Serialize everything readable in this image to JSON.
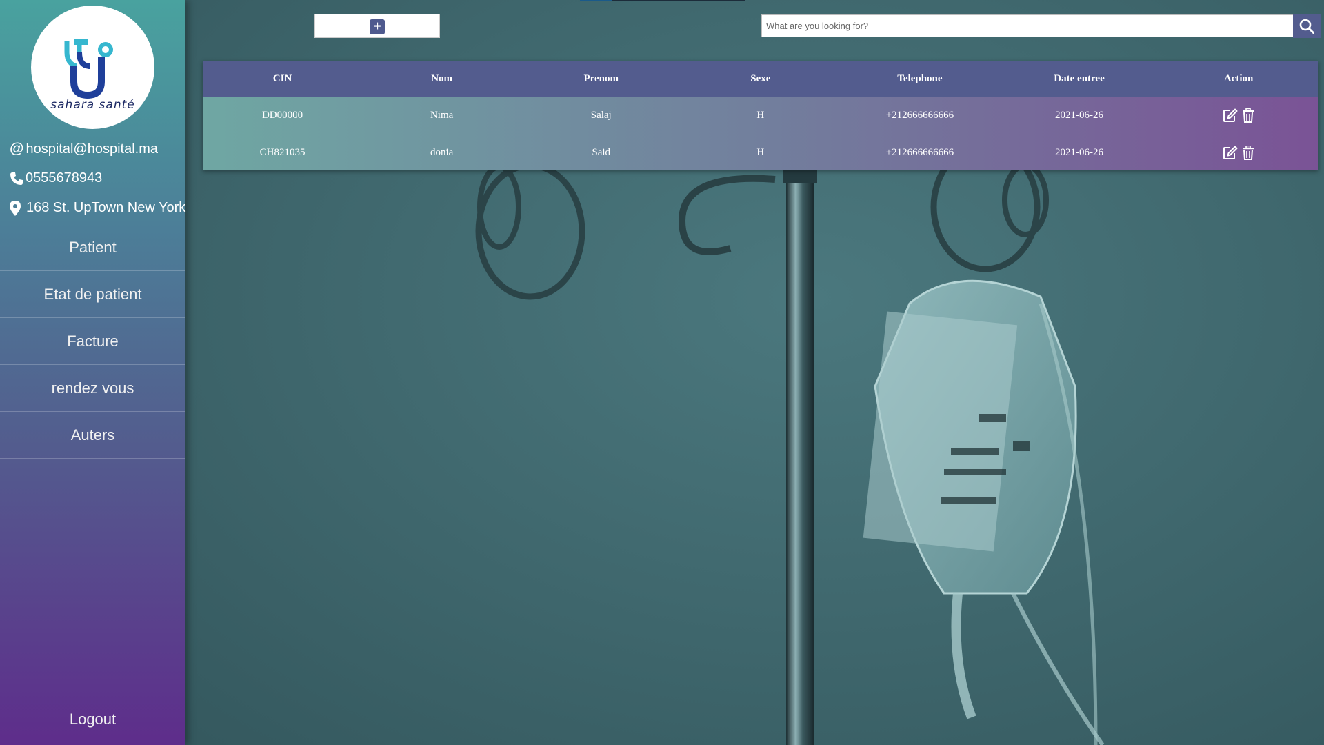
{
  "sidebar": {
    "logo_text": "sahara santé",
    "contact": {
      "email": "hospital@hospital.ma",
      "phone": "0555678943",
      "address": "168 St. UpTown New York"
    },
    "nav_items": [
      {
        "label": "Patient"
      },
      {
        "label": "Etat de patient"
      },
      {
        "label": "Facture"
      },
      {
        "label": "rendez vous"
      },
      {
        "label": "Auters"
      }
    ],
    "logout_label": "Logout"
  },
  "toolbar": {
    "add_icon": "plus-square-icon",
    "search_placeholder": "What are you looking for?",
    "search_value": "",
    "search_icon": "search-icon"
  },
  "table": {
    "headers": [
      "CIN",
      "Nom",
      "Prenom",
      "Sexe",
      "Telephone",
      "Date entree",
      "Action"
    ],
    "rows": [
      {
        "cin": "DD00000",
        "nom": "Nima",
        "prenom": "Salaj",
        "sexe": "H",
        "telephone": "+212666666666",
        "date_entree": "2021-06-26"
      },
      {
        "cin": "CH821035",
        "nom": "donia",
        "prenom": "Said",
        "sexe": "H",
        "telephone": "+212666666666",
        "date_entree": "2021-06-26"
      }
    ],
    "action_icons": [
      "edit-icon",
      "trash-icon"
    ]
  },
  "colors": {
    "accent": "#535c8e",
    "sidebar_top": "#49a29f",
    "sidebar_bottom": "#5e2d8b"
  }
}
